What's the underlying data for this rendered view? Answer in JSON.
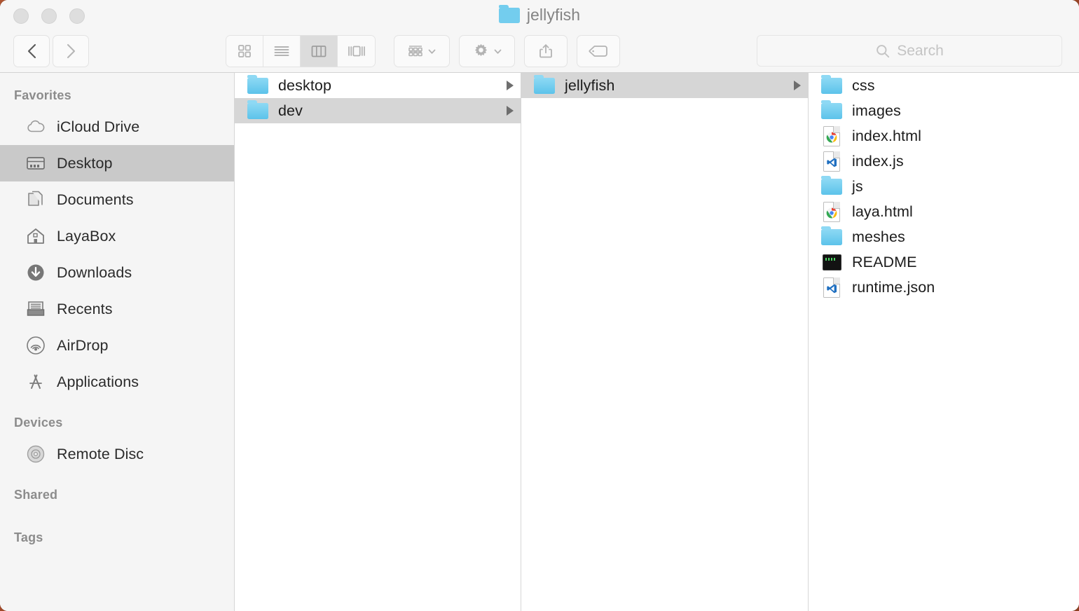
{
  "window": {
    "title": "jellyfish",
    "title_icon": "folder-icon",
    "traffic_lights": [
      "close-button",
      "minimize-button",
      "zoom-button"
    ]
  },
  "toolbar": {
    "back_label": "‹",
    "forward_label": "›",
    "view_buttons": [
      {
        "name": "icon-view",
        "icon": "grid-icon",
        "active": false
      },
      {
        "name": "list-view",
        "icon": "list-icon",
        "active": false
      },
      {
        "name": "column-view",
        "icon": "columns-icon",
        "active": true
      },
      {
        "name": "gallery-view",
        "icon": "gallery-icon",
        "active": false
      }
    ],
    "arrange_button": {
      "name": "arrange-by-button",
      "icon": "grid-rows-icon"
    },
    "action_button": {
      "name": "action-menu-button",
      "icon": "gear-icon"
    },
    "share_button": {
      "name": "share-button",
      "icon": "share-icon"
    },
    "tag_button": {
      "name": "tag-button",
      "icon": "tag-icon"
    }
  },
  "search": {
    "placeholder": "Search",
    "value": "",
    "icon": "search-icon"
  },
  "sidebar": {
    "sections": [
      {
        "header": "Favorites",
        "items": [
          {
            "label": "iCloud Drive",
            "icon": "cloud-icon",
            "selected": false
          },
          {
            "label": "Desktop",
            "icon": "desktop-icon",
            "selected": true
          },
          {
            "label": "Documents",
            "icon": "documents-icon",
            "selected": false
          },
          {
            "label": "LayaBox",
            "icon": "home-icon",
            "selected": false
          },
          {
            "label": "Downloads",
            "icon": "download-icon",
            "selected": false
          },
          {
            "label": "Recents",
            "icon": "recents-icon",
            "selected": false
          },
          {
            "label": "AirDrop",
            "icon": "airdrop-icon",
            "selected": false
          },
          {
            "label": "Applications",
            "icon": "applications-icon",
            "selected": false
          }
        ]
      },
      {
        "header": "Devices",
        "items": [
          {
            "label": "Remote Disc",
            "icon": "disc-icon",
            "selected": false
          }
        ]
      },
      {
        "header": "Shared",
        "items": []
      },
      {
        "header": "Tags",
        "items": []
      }
    ]
  },
  "columns": [
    {
      "name": "column-1",
      "rows": [
        {
          "label": "desktop",
          "icon": "folder-icon",
          "selected": false,
          "disclosure": true
        },
        {
          "label": "dev",
          "icon": "folder-icon",
          "selected": true,
          "disclosure": true
        }
      ]
    },
    {
      "name": "column-2",
      "rows": [
        {
          "label": "jellyfish",
          "icon": "folder-icon",
          "selected": true,
          "disclosure": true
        }
      ]
    },
    {
      "name": "column-3",
      "rows": [
        {
          "label": "css",
          "icon": "folder-icon",
          "selected": false,
          "disclosure": false
        },
        {
          "label": "images",
          "icon": "folder-icon",
          "selected": false,
          "disclosure": false
        },
        {
          "label": "index.html",
          "icon": "chrome-document-icon",
          "selected": false,
          "disclosure": false
        },
        {
          "label": "index.js",
          "icon": "vscode-document-icon",
          "selected": false,
          "disclosure": false
        },
        {
          "label": "js",
          "icon": "folder-icon",
          "selected": false,
          "disclosure": false
        },
        {
          "label": "laya.html",
          "icon": "chrome-document-icon",
          "selected": false,
          "disclosure": false
        },
        {
          "label": "meshes",
          "icon": "folder-icon",
          "selected": false,
          "disclosure": false
        },
        {
          "label": "README",
          "icon": "terminal-document-icon",
          "selected": false,
          "disclosure": false
        },
        {
          "label": "runtime.json",
          "icon": "vscode-document-icon",
          "selected": false,
          "disclosure": false
        }
      ]
    }
  ],
  "colors": {
    "folder_blue": "#73cdee",
    "selection_gray": "#d6d6d6",
    "sidebar_selection": "#c9c9c9",
    "desktop_background": "#9c4526",
    "chrome_blue": "#4285f4",
    "vscode_blue": "#1f6fc0"
  }
}
